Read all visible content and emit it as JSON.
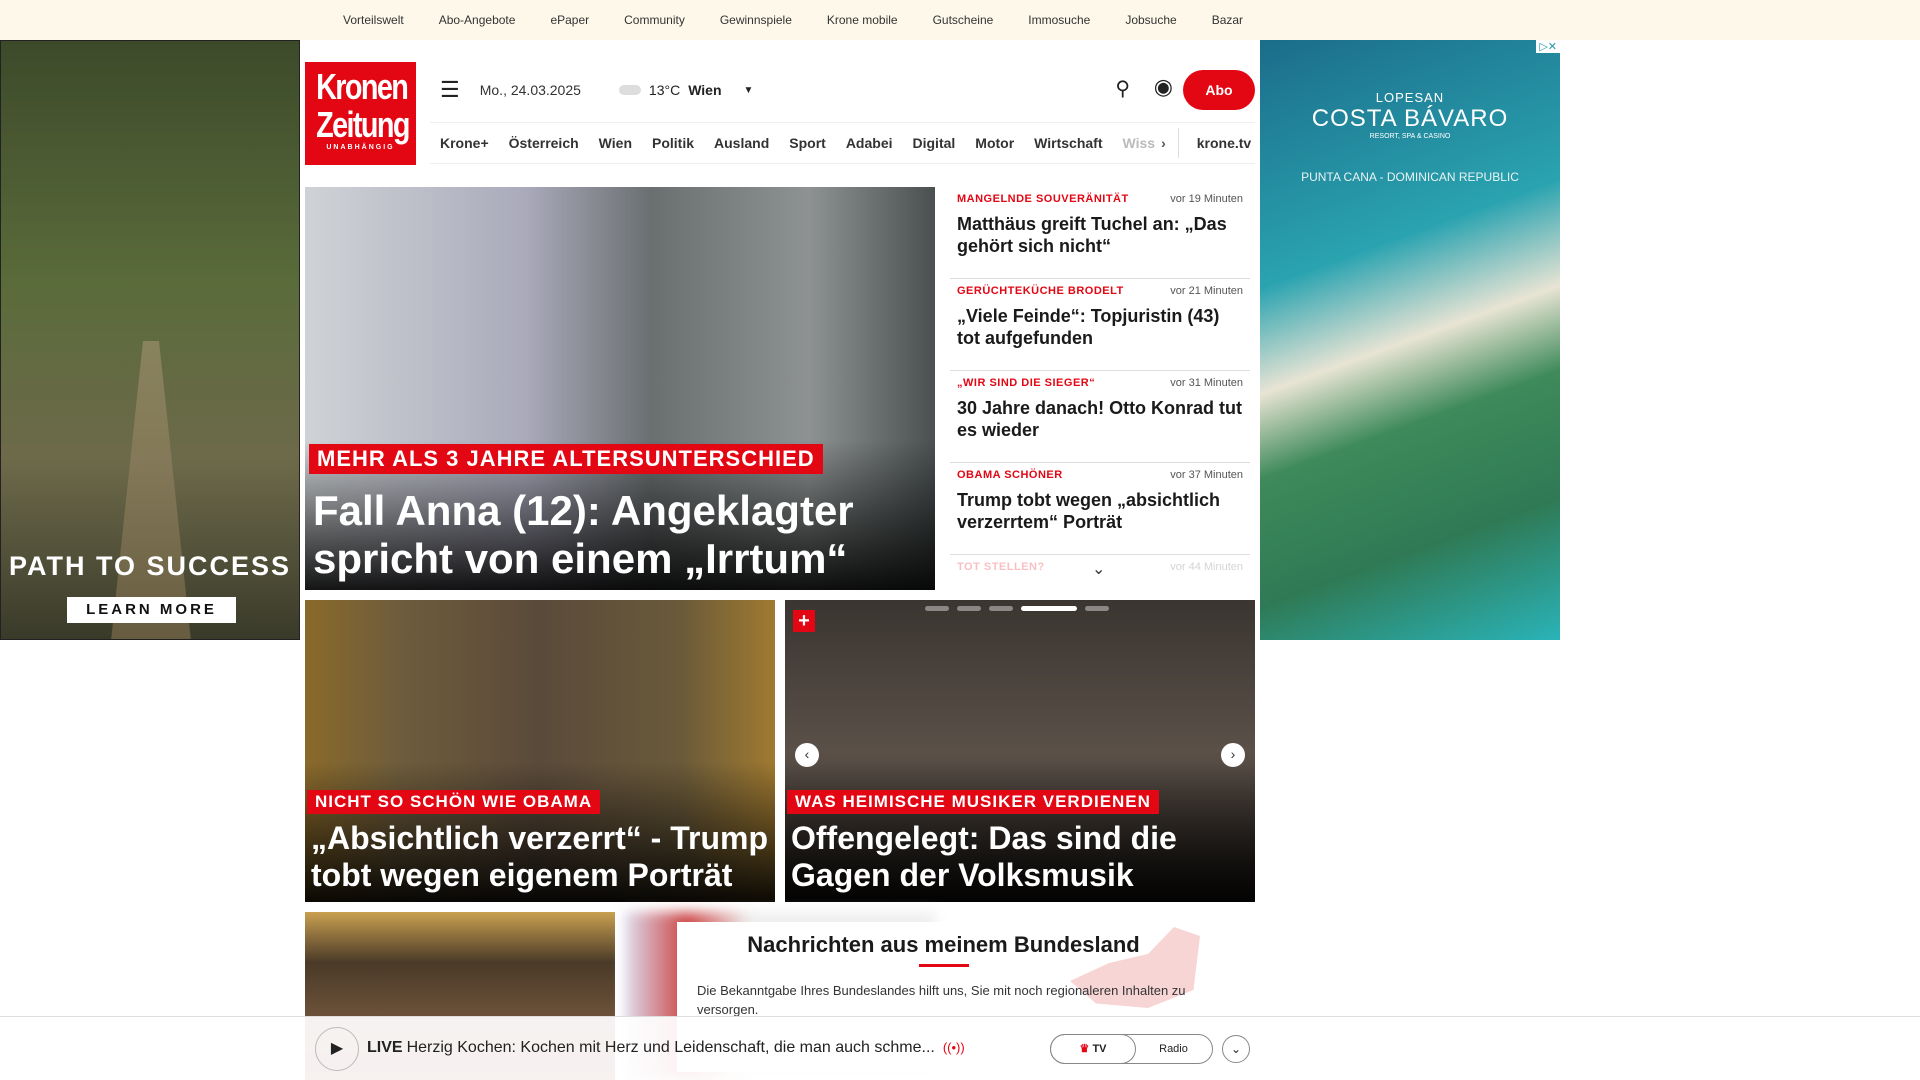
{
  "topbar": [
    "Vorteilswelt",
    "Abo-Angebote",
    "ePaper",
    "Community",
    "Gewinnspiele",
    "Krone mobile",
    "Gutscheine",
    "Immosuche",
    "Jobsuche",
    "Bazar"
  ],
  "ad_left": {
    "headline": "PATH TO SUCCESS",
    "cta": "LEARN MORE"
  },
  "ad_right": {
    "brand_top": "LOPESAN",
    "brand": "COSTA BÁVARO",
    "brand_sub": "RESORT, SPA & CASINO",
    "location": "PUNTA CANA - DOMINICAN REPUBLIC"
  },
  "logo": {
    "line1": "Kronen",
    "line2": "Zeitung",
    "tagline": "UNABHÄNGIG"
  },
  "header": {
    "date": "Mo., 24.03.2025",
    "temp": "13°C",
    "city": "Wien",
    "abo": "Abo"
  },
  "nav": [
    "Krone+",
    "Österreich",
    "Wien",
    "Politik",
    "Ausland",
    "Sport",
    "Adabei",
    "Digital",
    "Motor",
    "Wirtschaft",
    "Wiss"
  ],
  "nav_tv": "krone.tv",
  "hero": {
    "kicker": "MEHR ALS 3 JAHRE ALTERSUNTERSCHIED",
    "title": "Fall Anna (12): Angeklagter spricht von einem „Irrtum“"
  },
  "news": [
    {
      "kicker": "MANGELNDE SOUVERÄNITÄT",
      "time": "vor 19 Minuten",
      "title": "Matthäus greift Tuchel an: „Das gehört sich nicht“"
    },
    {
      "kicker": "GERÜCHTEKÜCHE BRODELT",
      "time": "vor 21 Minuten",
      "title": "„Viele Feinde“: Topjuristin (43) tot aufgefunden"
    },
    {
      "kicker": "„WIR SIND DIE SIEGER“",
      "time": "vor 31 Minuten",
      "title": "30 Jahre danach! Otto Konrad tut es wieder"
    },
    {
      "kicker": "OBAMA SCHÖNER",
      "time": "vor 37 Minuten",
      "title": "Trump tobt wegen „absichtlich verzerrtem“ Porträt"
    },
    {
      "kicker": "TOT STELLEN?",
      "time": "vor 44 Minuten",
      "title": ""
    }
  ],
  "cards": [
    {
      "kicker": "NICHT SO SCHÖN WIE OBAMA",
      "title": "„Absichtlich verzerrt“ - Trump tobt wegen eigenem Porträt"
    },
    {
      "kicker": "WAS HEIMISCHE MUSIKER VERDIENEN",
      "title": "Offengelegt: Das sind die Gagen der Volksmusik"
    }
  ],
  "bundesland": {
    "title": "Nachrichten aus meinem Bundesland",
    "text": "Die Bekanntgabe Ihres Bundeslandes hilft uns, Sie mit noch regionaleren Inhalten zu versorgen."
  },
  "live": {
    "label": "LIVE",
    "text": "Herzig Kochen: Kochen mit Herz und Leidenschaft, die man auch schme...",
    "tv": "TV",
    "radio": "Radio"
  },
  "colors": {
    "brand": "#e30613",
    "topbar": "#fdf8ea"
  }
}
